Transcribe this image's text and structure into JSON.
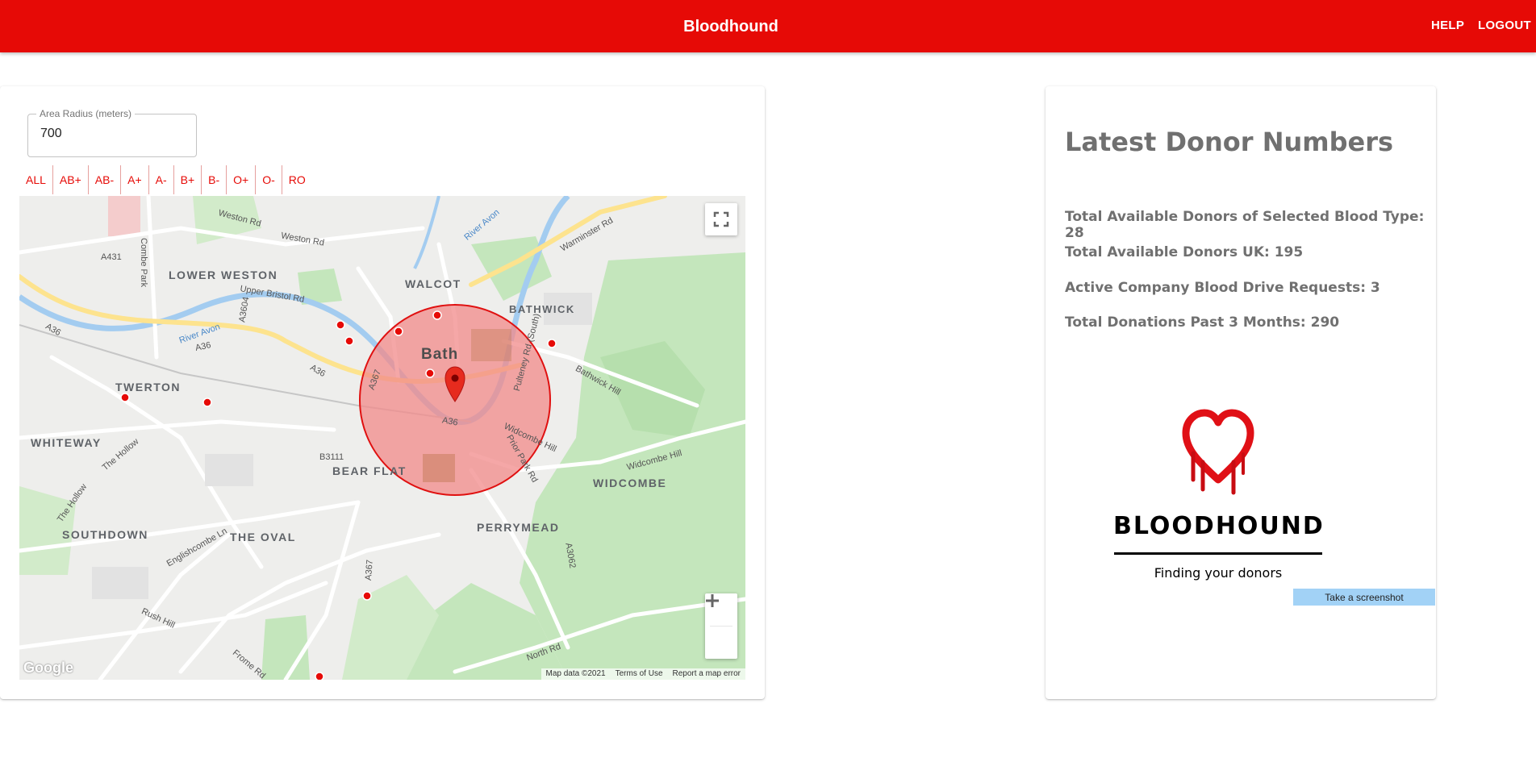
{
  "appbar": {
    "title": "Bloodhound",
    "help_label": "HELP",
    "logout_label": "LOGOUT",
    "color": "#e60a06"
  },
  "map_panel": {
    "radius_label": "Area Radius (meters)",
    "radius_value": "700",
    "filters": [
      "ALL",
      "AB+",
      "AB-",
      "A+",
      "A-",
      "B+",
      "B-",
      "O+",
      "O-",
      "RO"
    ],
    "map": {
      "area_labels": [
        "LOWER WESTON",
        "WALCOT",
        "BATHWICK",
        "TWERTON",
        "WHITEWAY",
        "BEAR FLAT",
        "WIDCOMBE",
        "PERRYMEAD",
        "SOUTHDOWN",
        "THE OVAL"
      ],
      "city_label": "Bath",
      "road_labels": [
        "Weston Rd",
        "Weston Rd",
        "A431",
        "Combe Park",
        "Upper Bristol Rd",
        "A3604",
        "A36",
        "A36",
        "A36",
        "A36",
        "A367",
        "A367",
        "Warminster Rd",
        "Pulteney Rd (South)",
        "Bathwick Hill",
        "Widcombe Hill",
        "Widcombe Hill",
        "Prior Park Rd",
        "B3111",
        "The Hollow",
        "The Hollow",
        "Englishcombe Ln",
        "A3062",
        "Rush Hill",
        "North Rd",
        "Frome Rd"
      ],
      "water_labels": [
        "River Avon",
        "River Avon"
      ],
      "search_radius_color": "#f28a8a",
      "donor_marker_color": "#e60a06",
      "google_logo": "Google",
      "footer": [
        "Map data ©2021",
        "Terms of Use",
        "Report a map error"
      ],
      "controls": [
        "fullscreen-icon",
        "zoom-in-icon",
        "zoom-out-icon"
      ]
    }
  },
  "stats_panel": {
    "heading": "Latest Donor Numbers",
    "lines": [
      "Total Available Donors of Selected Blood Type: 28",
      "Total Available Donors UK: 195",
      "Active Company Blood Drive Requests: 3",
      "Total Donations Past 3 Months: 290"
    ],
    "logo_word": "BLOODHOUND",
    "logo_tagline": "Finding your donors",
    "logo_icon": "bleeding-heart-icon"
  },
  "screenshot_button": "Take a screenshot"
}
